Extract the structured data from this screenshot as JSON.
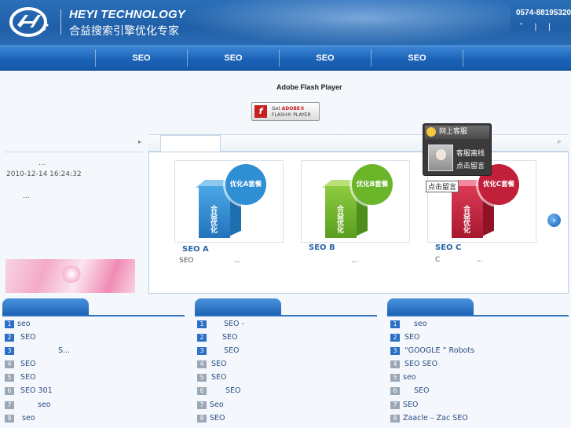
{
  "header": {
    "brand_en": "HEYI TECHNOLOGY",
    "brand_cn": "合益搜索引擎优化专家",
    "phone": "0574-88195320",
    "links": [
      "˅",
      "|",
      "|"
    ]
  },
  "nav": [
    "SEO",
    "SEO",
    "SEO",
    "SEO"
  ],
  "flash": {
    "title": "Adobe Flash Player",
    "get": "Get",
    "adobe": "ADOBE®",
    "player": "FLASH® PLAYER"
  },
  "left": {
    "dots1": "...",
    "date": "2010-12-14 16:24:32",
    "dots2": "..."
  },
  "products": [
    {
      "seal": "优化A套餐",
      "box_text": "合益优化",
      "label": "SEO  A",
      "sub": "SEO",
      "sub_dots": "...",
      "color": "#2f8fd3"
    },
    {
      "seal": "优化B套餐",
      "box_text": "合益优化",
      "label": "SEO  B",
      "sub": "",
      "sub_dots": "...",
      "color": "#6bb52a"
    },
    {
      "seal": "优化C套餐",
      "box_text": "合益优化",
      "label": "SEO  C",
      "sub": "C",
      "sub_dots": "...",
      "color": "#c2203a"
    }
  ],
  "service": {
    "title": "网上客服",
    "status1": "客服离线",
    "status2": "点击留言",
    "tooltip": "点击留言"
  },
  "lists": [
    {
      "items": [
        "seo",
        "SEO",
        "S...",
        "SEO",
        "SEO",
        "SEO  301",
        "seo",
        "seo"
      ]
    },
    {
      "items": [
        "SEO  -",
        "SEO",
        "SEO",
        "SEO",
        "SEO",
        "SEO",
        "Seo",
        "SEO"
      ]
    },
    {
      "items": [
        "seo",
        "SEO",
        "“GOOGLE ” Robots",
        "SEO  SEO",
        "seo",
        "SEO",
        "SEO",
        "Zaacle – Zac SEO"
      ]
    }
  ]
}
